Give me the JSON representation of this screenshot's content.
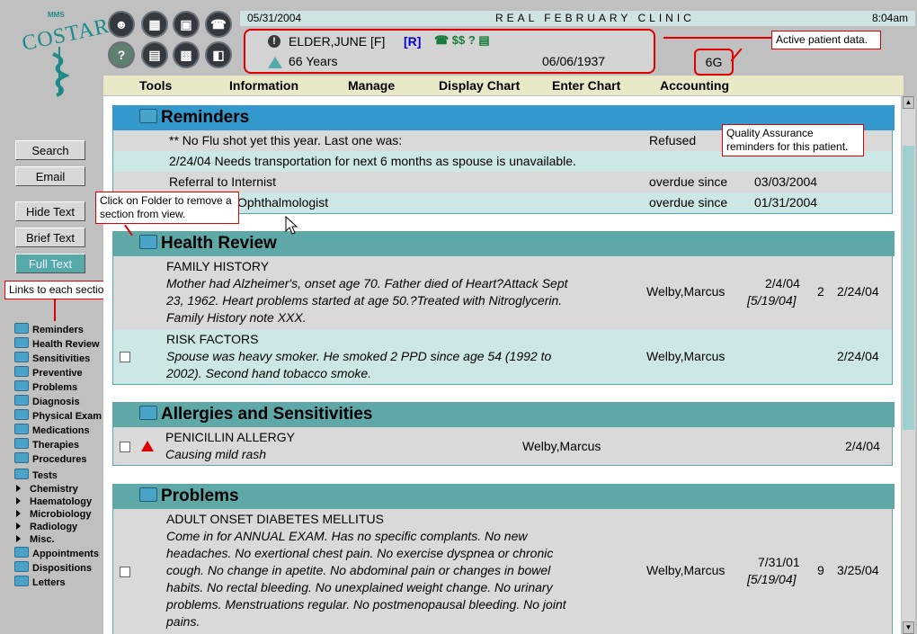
{
  "logo": {
    "mini": "MMS",
    "word": "COSTAR"
  },
  "toolbar_icons": [
    "person-icon",
    "calendar-icon",
    "save-disk-icon",
    "phone-icon",
    "help-icon",
    "window-icon",
    "printer-icon",
    "exit-door-icon"
  ],
  "header": {
    "date": "05/31/2004",
    "clinic": "REAL FEBRUARY CLINIC",
    "time": "8:04am"
  },
  "patient": {
    "name": "ELDER,JUNE [F]",
    "r_flag": "[R]",
    "icons": "☎ $$ ? ▤",
    "age": "66 Years",
    "dob": "06/06/1937",
    "room": "6G"
  },
  "notes": {
    "active_patient": "Active patient data.",
    "quality_assurance": "Quality Assurance reminders for this patient.",
    "folder_hint": "Click on Folder to remove a section from view.",
    "links_hint": "Links to each section."
  },
  "menu": [
    "Tools",
    "Information",
    "Manage",
    "Display Chart",
    "Enter Chart",
    "Accounting"
  ],
  "nav_buttons": [
    "Search",
    "Email",
    "Hide Text",
    "Brief Text",
    "Full Text"
  ],
  "nav_sections": [
    "Reminders",
    "Health Review",
    "Sensitivities",
    "Preventive",
    "Problems",
    "Diagnosis",
    "Physical Exam",
    "Medications",
    "Therapies",
    "Procedures",
    "Tests"
  ],
  "nav_tests": [
    "Chemistry",
    "Haematology",
    "Microbiology",
    "Radiology",
    "Misc."
  ],
  "nav_bottom": [
    "Appointments",
    "Dispositions",
    "Letters"
  ],
  "reminders": {
    "title": "Reminders",
    "rows": [
      {
        "text": "** No Flu shot yet this year. Last one was:",
        "status": "Refused",
        "date": ""
      },
      {
        "text": "2/24/04 Needs transportation for next 6 months as spouse is unavailable.",
        "status": "",
        "date": ""
      },
      {
        "text": "Referral to Internist",
        "status": "overdue since",
        "date": "03/03/2004"
      },
      {
        "text": "Ophthalmologist",
        "status": "overdue since",
        "date": "01/31/2004"
      }
    ]
  },
  "health_review": {
    "title": "Health Review",
    "rows": [
      {
        "title": "FAMILY HISTORY",
        "lines": [
          "Mother had Alzheimer's, onset age 70. Father died of Heart?Attack Sept",
          "23, 1962. Heart problems started at age 50.?Treated with Nitroglycerin.",
          "Family History note XXX."
        ],
        "provider": "Welby,Marcus",
        "date1": "2/4/04",
        "date1b": "[5/19/04]",
        "count": "2",
        "date2": "2/24/04"
      },
      {
        "title": "RISK FACTORS",
        "lines": [
          "Spouse was heavy smoker. He smoked 2 PPD since age 54 (1992 to",
          "2002). Second hand tobacco smoke."
        ],
        "provider": "Welby,Marcus",
        "date2": "2/24/04"
      }
    ]
  },
  "allergies": {
    "title": "Allergies and Sensitivities",
    "rows": [
      {
        "title": "PENICILLIN ALLERGY",
        "sub": "Causing mild rash",
        "provider": "Welby,Marcus",
        "date": "2/4/04"
      }
    ]
  },
  "problems": {
    "title": "Problems",
    "rows": [
      {
        "title": "ADULT ONSET DIABETES MELLITUS",
        "lines": [
          "Come in for ANNUAL EXAM. Has no specific complants. No new",
          "headaches. No exertional chest pain. No exercise dyspnea or chronic",
          "cough. No change in apetite. No abdominal pain or changes in bowel",
          "habits. No rectal bleeding. No unexplained weight change. No urinary",
          "problems. Menstruations regular. No postmenopausal bleeding. No joint",
          "pains."
        ],
        "provider": "Welby,Marcus",
        "date1": "7/31/01",
        "date1b": "[5/19/04]",
        "count": "9",
        "date2": "3/25/04"
      }
    ]
  },
  "colors": {
    "section_blue": "#3399cc",
    "section_teal": "#5fa8a8",
    "row_teal": "#cde7e7",
    "row_gray": "#d9d9d9",
    "accent_red": "#e00000"
  }
}
